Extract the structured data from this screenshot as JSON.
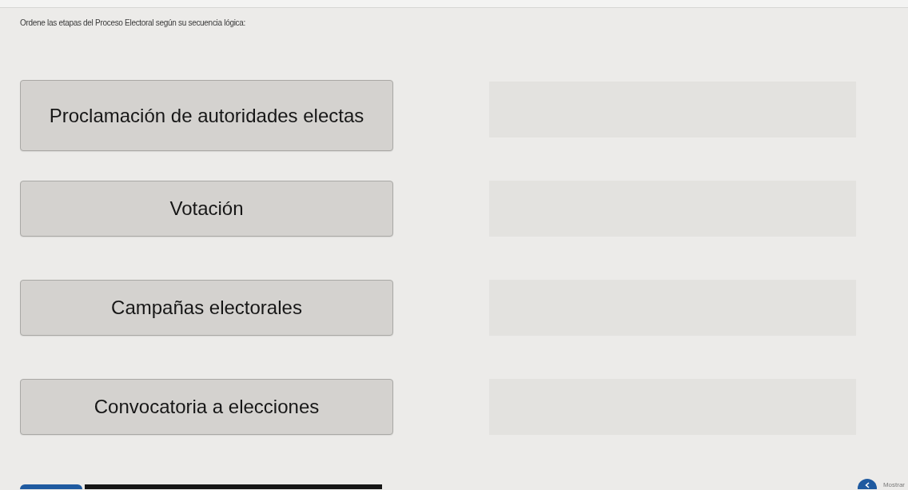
{
  "question": "Ordene las etapas del Proceso Electoral según su secuencia lógica:",
  "rows": [
    {
      "item": {
        "label": "Proclamación de autoridades electas"
      },
      "drop_zone": {
        "filled": false
      }
    },
    {
      "item": {
        "label": "Votación"
      },
      "drop_zone": {
        "filled": false
      }
    },
    {
      "item": {
        "label": "Campañas electorales"
      },
      "drop_zone": {
        "filled": false
      }
    },
    {
      "item": {
        "label": "Convocatoria a elecciones"
      },
      "drop_zone": {
        "filled": false
      }
    }
  ],
  "footer": {
    "link": "Mostrar"
  }
}
